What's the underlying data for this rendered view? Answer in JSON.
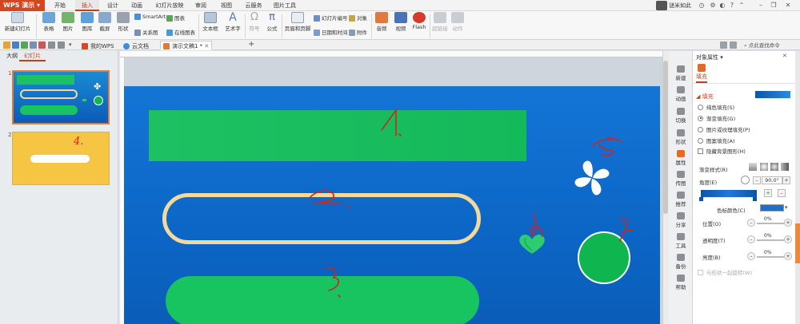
{
  "app": {
    "name": "WPS 演示"
  },
  "menu": [
    "开始",
    "插入",
    "设计",
    "动画",
    "幻灯片放映",
    "审阅",
    "视图",
    "云服务",
    "图片工具"
  ],
  "menu_active": "插入",
  "user": {
    "name": "谜米如此"
  },
  "ribbon": {
    "new_slide": "新建幻灯片",
    "table": "表格",
    "image": "图片",
    "gallery": "图库",
    "screenshot": "截屏",
    "shape": "形状",
    "smartart": "SmartArt",
    "chart": "图表",
    "relation": "关系图",
    "online_chart": "在线图表",
    "textbox": "文本框",
    "wordart": "艺术字",
    "symbol": "符号",
    "formula": "公式",
    "header_footer": "页眉和页脚",
    "slide_number": "幻灯片编号",
    "object": "对象",
    "datetime": "日期和时间",
    "attachment": "附件",
    "audio": "音频",
    "video": "视频",
    "flash": "Flash",
    "hyperlink": "超链接",
    "action": "动作"
  },
  "tabs": [
    {
      "label": "我的WPS"
    },
    {
      "label": "云文档"
    },
    {
      "label": "演示文稿1 *"
    }
  ],
  "search_cmd": "点此查找命令",
  "left_pane": {
    "tabs": [
      "大纲",
      "幻灯片"
    ],
    "active": "幻灯片",
    "slide_numbers": [
      "1",
      "2"
    ]
  },
  "thumb2_annotation": "4.",
  "props": {
    "title": "对象属性",
    "tab": "填充",
    "section": "填充",
    "fill_options": [
      "纯色填充(S)",
      "渐变填充(G)",
      "图片或纹理填充(P)",
      "图案填充(A)"
    ],
    "fill_selected": "渐变填充(G)",
    "hide_bg": "隐藏背景图形(H)",
    "gradient_style": "渐变样式(R)",
    "angle_label": "角度(E)",
    "angle_value": "90.0°",
    "stop_color": "色标颜色(C)",
    "position": "位置(O)",
    "transparency": "透明度(T)",
    "brightness": "亮度(B)",
    "pos_val": "0%",
    "trans_val": "0%",
    "bright_val": "0%",
    "rotate_with_shape": "与形状一起旋转(W)"
  },
  "side_tools": [
    "新建",
    "动画",
    "切换",
    "形状",
    "属性",
    "传图",
    "推荐",
    "分享",
    "工具",
    "备份",
    "帮助"
  ],
  "side_active": "属性",
  "colors": {
    "accent": "#c24016",
    "slide_blue": "#1475d6",
    "green": "#17c45f",
    "cream": "#f3d99c"
  }
}
